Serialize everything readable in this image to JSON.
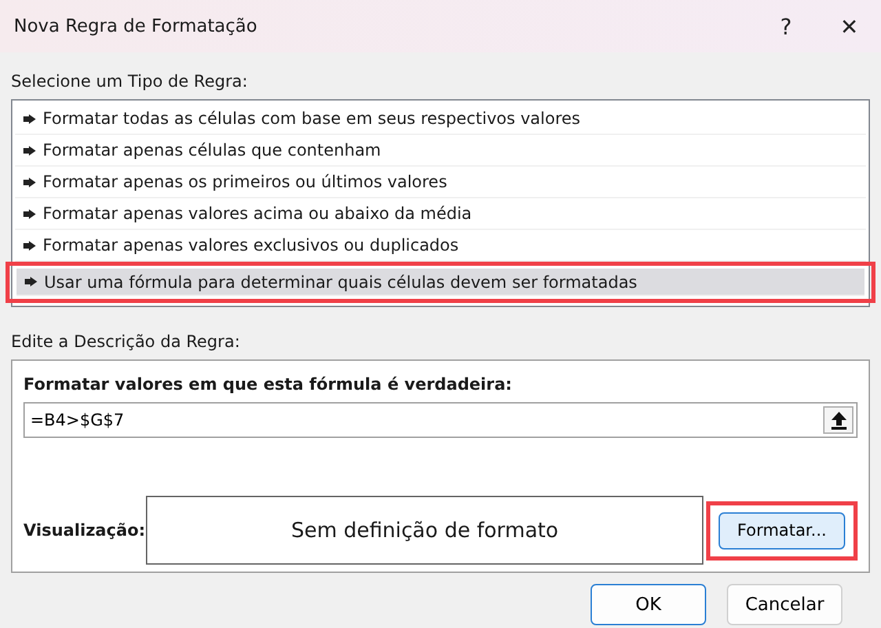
{
  "window": {
    "title": "Nova Regra de Formatação",
    "help": "?",
    "close": "✕"
  },
  "rule_type": {
    "label": "Selecione um Tipo de Regra:",
    "items": [
      {
        "text": "Formatar todas as células com base em seus respectivos valores",
        "selected": false,
        "highlighted": false
      },
      {
        "text": "Formatar apenas células que contenham",
        "selected": false,
        "highlighted": false
      },
      {
        "text": "Formatar apenas os primeiros ou últimos valores",
        "selected": false,
        "highlighted": false
      },
      {
        "text": "Formatar apenas valores acima ou abaixo da média",
        "selected": false,
        "highlighted": false
      },
      {
        "text": "Formatar apenas valores exclusivos ou duplicados",
        "selected": false,
        "highlighted": false
      },
      {
        "text": "Usar uma fórmula para determinar quais células devem ser formatadas",
        "selected": true,
        "highlighted": true
      }
    ]
  },
  "description": {
    "label": "Edite a Descrição da Regra:",
    "formula_label": "Formatar valores em que esta fórmula é verdadeira:",
    "formula": "=B4>$G$7",
    "preview_label": "Visualização:",
    "preview_text": "Sem definição de formato",
    "format_button": {
      "label": "Formatar...",
      "highlighted": true
    }
  },
  "buttons": [
    "OK",
    "Cancelar"
  ]
}
